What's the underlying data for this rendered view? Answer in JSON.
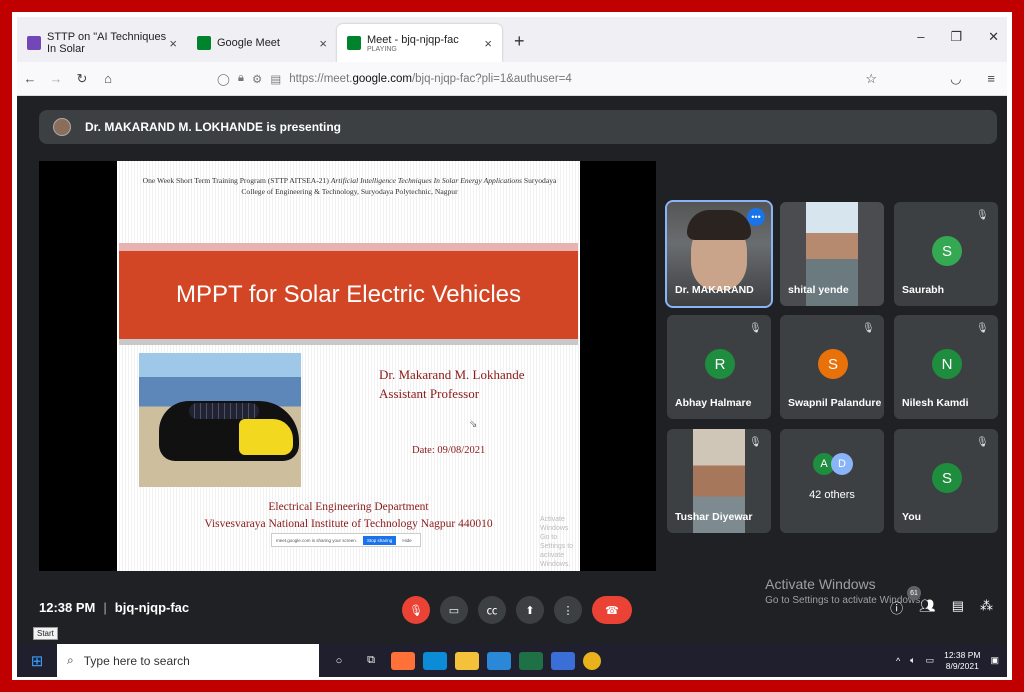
{
  "browser": {
    "tabs": [
      {
        "title": "STTP on \"AI Techniques In Solar",
        "icon": "form-icon",
        "color": "#7248b9"
      },
      {
        "title": "Google Meet",
        "icon": "meet-icon",
        "color": "#00832d"
      },
      {
        "title": "Meet - bjq-njqp-fac",
        "subtitle": "PLAYING",
        "icon": "meet-icon",
        "color": "#00832d"
      }
    ],
    "url_prefix": "https://meet.",
    "url_host": "google.com",
    "url_path": "/bjq-njqp-fac?pli=1&authuser=4"
  },
  "meet": {
    "presenting": "Dr. MAKARAND M. LOKHANDE is presenting",
    "time": "12:38 PM",
    "code": "bjq-njqp-fac",
    "participants_badge": "61",
    "activate_title": "Activate Windows",
    "activate_sub": "Go to Settings to activate Windows."
  },
  "slide": {
    "header_plain": "One Week Short Term Training Program (STTP AITSEA-21)",
    "header_italic": "Artificial Intelligence Techniques In Solar Energy Applications",
    "header_tail": "Suryodaya College of Engineering & Technology, Suryodaya Polytechnic, Nagpur",
    "title": "MPPT for Solar Electric Vehicles",
    "name": "Dr. Makarand M. Lokhande",
    "role": "Assistant Professor",
    "date": "Date: 09/08/2021",
    "dept": "Electrical Engineering Department",
    "institute": "Visvesvaraya National Institute of Technology Nagpur 440010",
    "share_text": "meet.google.com is sharing your screen.",
    "stop_sharing": "Stop sharing",
    "hide": "Hide",
    "wm1": "Activate Windows",
    "wm2": "Go to Settings to activate Windows."
  },
  "tiles": [
    {
      "name": "Dr. MAKARAND",
      "type": "video",
      "active": true
    },
    {
      "name": "shital yende",
      "type": "video"
    },
    {
      "name": "Saurabh",
      "letter": "S",
      "color": "#34a853"
    },
    {
      "name": "Abhay Halmare",
      "letter": "R",
      "color": "#1e8e3e"
    },
    {
      "name": "Swapnil Palandure",
      "letter": "S",
      "color": "#e8710a"
    },
    {
      "name": "Nilesh Kamdi",
      "letter": "N",
      "color": "#1e8e3e"
    },
    {
      "name": "Tushar Diyewar",
      "type": "video"
    },
    {
      "name": "42 others",
      "type": "others",
      "av1": "A",
      "av2": "D"
    },
    {
      "name": "You",
      "letter": "S",
      "color": "#1e8e3e"
    }
  ],
  "taskbar": {
    "start_tip": "Start",
    "search_placeholder": "Type here to search",
    "time": "12:38 PM",
    "date": "8/9/2021"
  }
}
